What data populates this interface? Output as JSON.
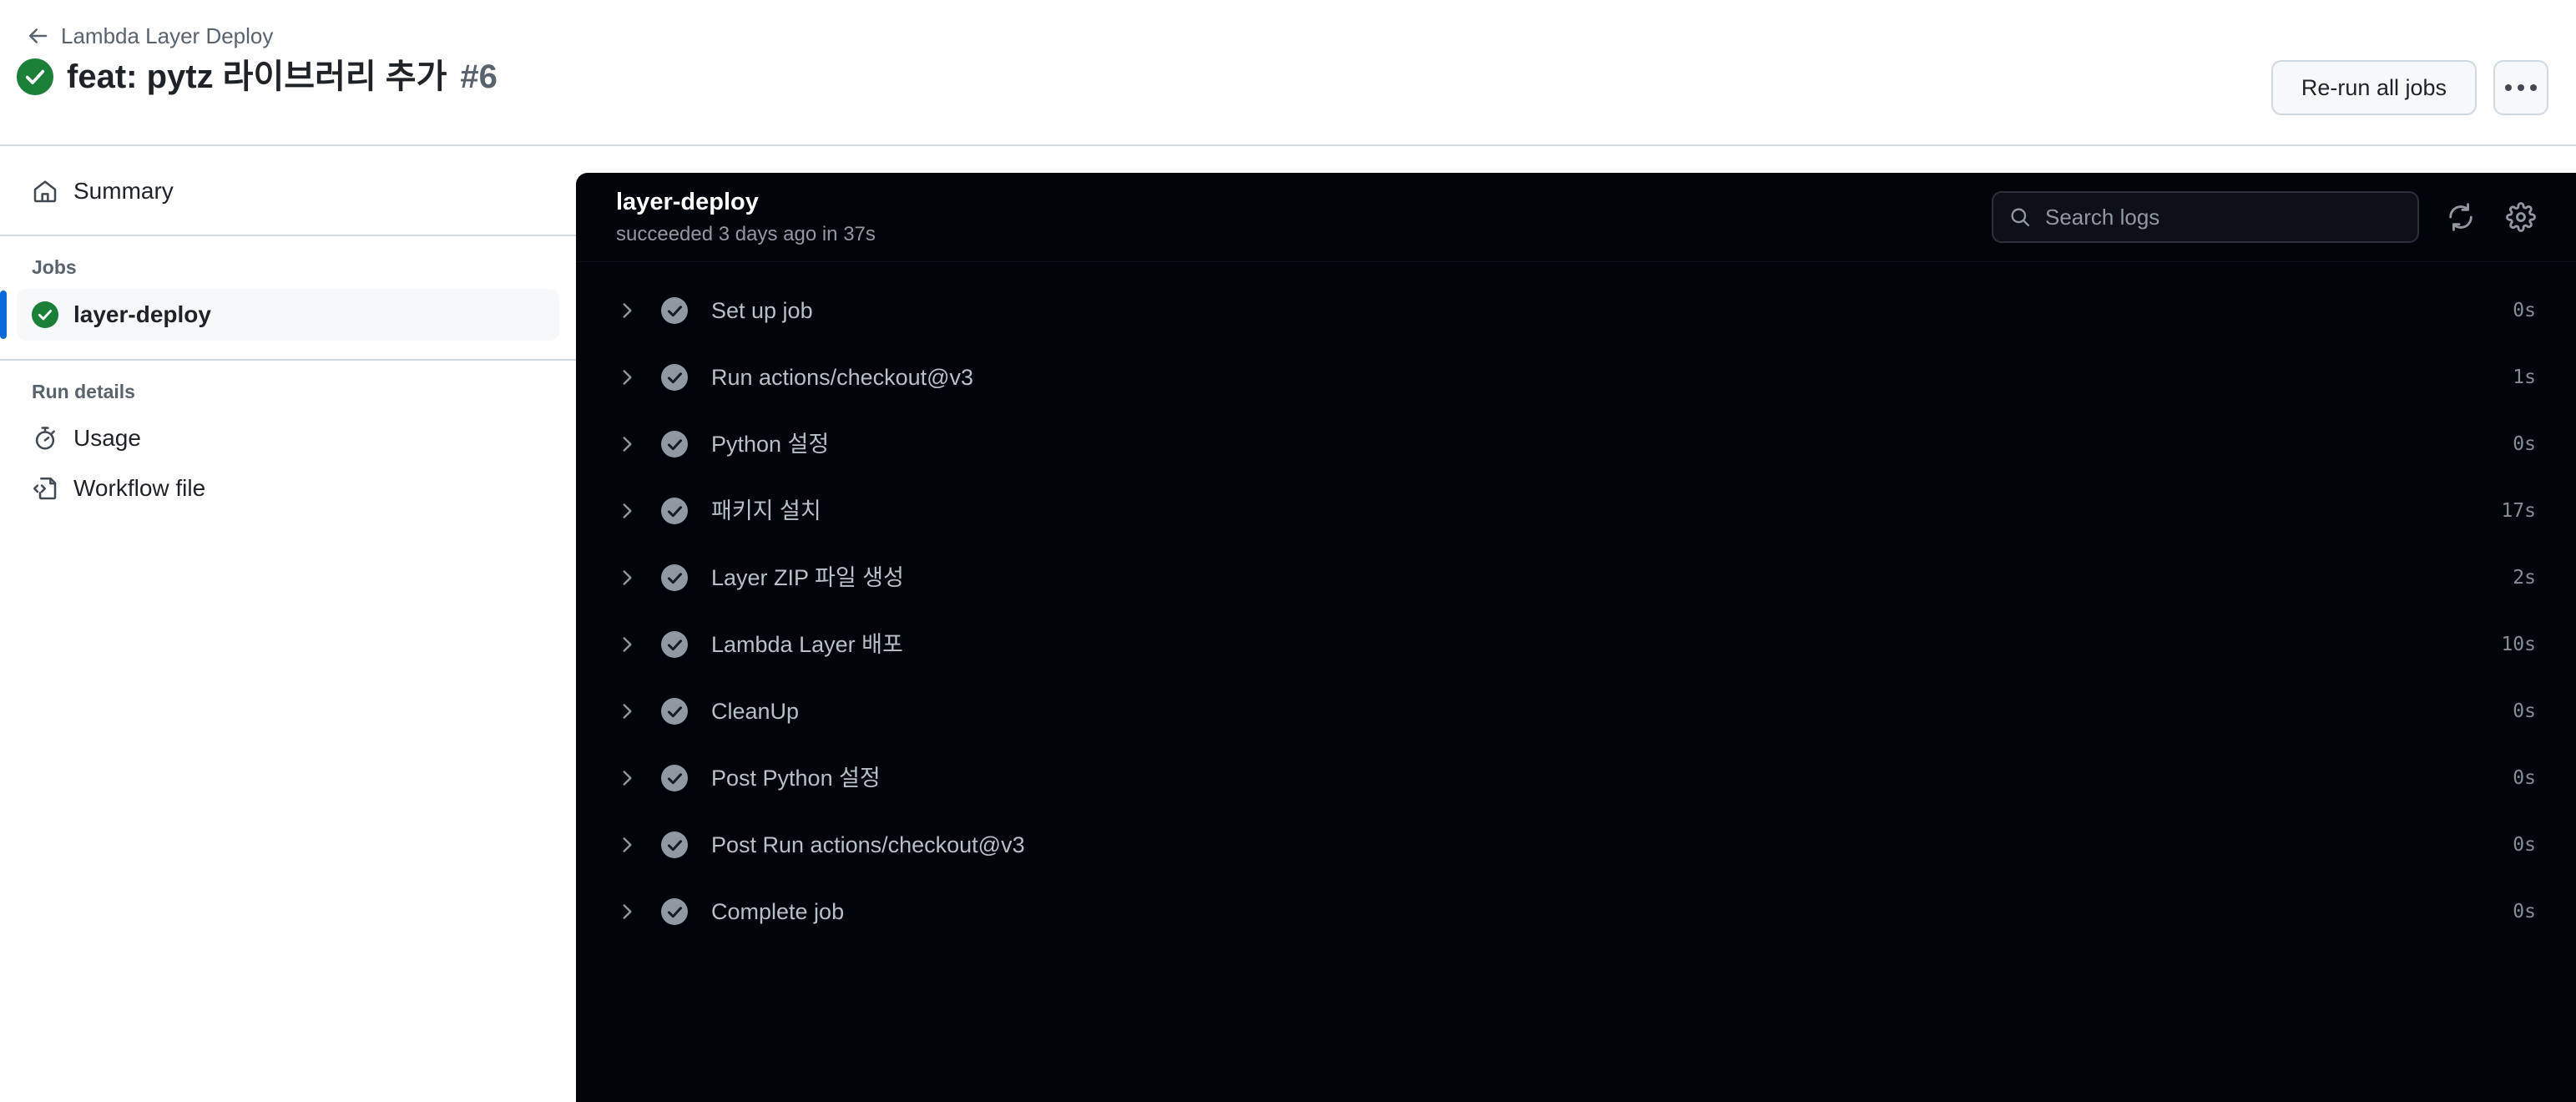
{
  "header": {
    "breadcrumb_label": "Lambda Layer Deploy",
    "back_icon": "arrow-left-icon",
    "run_title": "feat: pytz 라이브러리 추가",
    "run_number": "#6",
    "run_status_icon": "check-circle-icon",
    "run_status_color": "#1a7f37",
    "rerun_label": "Re-run all jobs",
    "kebab_icon": "kebab-horizontal-icon"
  },
  "sidebar": {
    "summary": {
      "label": "Summary",
      "icon": "home-icon"
    },
    "jobs_section_title": "Jobs",
    "jobs": [
      {
        "label": "layer-deploy",
        "status_icon": "check-circle-icon",
        "status_color": "#1a7f37",
        "selected": true
      }
    ],
    "run_details_section_title": "Run details",
    "run_details": [
      {
        "label": "Usage",
        "icon": "stopwatch-icon"
      },
      {
        "label": "Workflow file",
        "icon": "file-code-icon"
      }
    ],
    "accent_color": "#0969da"
  },
  "log_panel": {
    "job_name": "layer-deploy",
    "job_status": "succeeded 3 days ago in 37s",
    "background_color": "#010409",
    "search": {
      "placeholder": "Search logs",
      "value": "",
      "icon": "search-icon"
    },
    "tools": [
      {
        "name": "refresh-icon",
        "label": "Refresh logs"
      },
      {
        "name": "gear-icon",
        "label": "Settings"
      }
    ],
    "steps": [
      {
        "name": "Set up job",
        "duration": "0s",
        "status": "success"
      },
      {
        "name": "Run actions/checkout@v3",
        "duration": "1s",
        "status": "success"
      },
      {
        "name": "Python 설정",
        "duration": "0s",
        "status": "success"
      },
      {
        "name": "패키지 설치",
        "duration": "17s",
        "status": "success"
      },
      {
        "name": "Layer ZIP 파일 생성",
        "duration": "2s",
        "status": "success"
      },
      {
        "name": "Lambda Layer 배포",
        "duration": "10s",
        "status": "success"
      },
      {
        "name": "CleanUp",
        "duration": "0s",
        "status": "success"
      },
      {
        "name": "Post Python 설정",
        "duration": "0s",
        "status": "success"
      },
      {
        "name": "Post Run actions/checkout@v3",
        "duration": "0s",
        "status": "success"
      },
      {
        "name": "Complete job",
        "duration": "0s",
        "status": "success"
      }
    ]
  }
}
